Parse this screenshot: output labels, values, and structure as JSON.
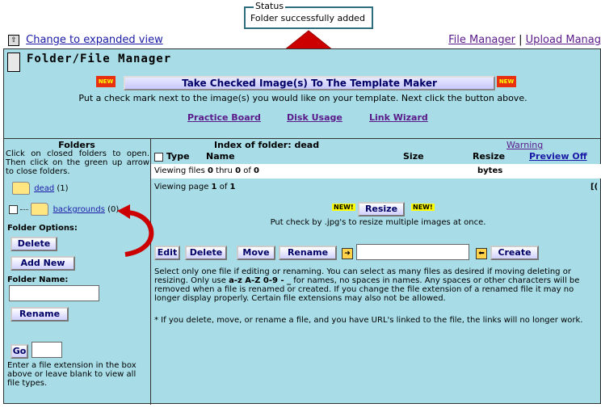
{
  "status": {
    "legend": "Status",
    "message": "Folder successfully added"
  },
  "top": {
    "expanded_link": "Change to expanded view",
    "file_manager_link": "File Manager",
    "separator": "|",
    "upload_link": "Upload Manag"
  },
  "header": {
    "title": "Folder/File Manager",
    "take_button": "Take Checked Image(s) To The Template Maker",
    "new_badge": "NEW",
    "instructions": "Put a check mark next to the image(s) you would like on your template. Next click the button above.",
    "links": [
      "Practice Board",
      "Disk Usage",
      "Link Wizard"
    ]
  },
  "sidebar": {
    "title": "Folders",
    "help": "Click on closed folders to open. Then click on the green up arrow to close folders.",
    "folders": [
      {
        "name": "dead",
        "count": "(1)"
      },
      {
        "name": "backgrounds",
        "count": "(0)"
      }
    ],
    "options_label": "Folder Options:",
    "delete_button": "Delete",
    "add_new_button": "Add New",
    "folder_name_label": "Folder Name:",
    "rename_button": "Rename",
    "go_button": "Go",
    "extension_note": "Enter a file extension in the box above or leave blank to view all file types."
  },
  "main": {
    "index_title": "Index of folder: dead",
    "warning_link": "Warning",
    "columns": [
      "Type",
      "Name",
      "Size",
      "Resize"
    ],
    "preview_link": "Preview Off",
    "viewing_files_prefix": "Viewing files",
    "viewing_files_from": "0",
    "viewing_files_mid": "thru",
    "viewing_files_to": "0",
    "viewing_files_of": "of",
    "viewing_files_total": "0",
    "bytes_label": "bytes",
    "viewing_page_prefix": "Viewing page",
    "page_current": "1",
    "page_of": "of",
    "page_total": "1",
    "page_right_marker": "[(",
    "new_label": "NEW!",
    "resize_button": "Resize",
    "resize_help": "Put check by .jpg's to resize multiple images at once.",
    "actions": {
      "edit": "Edit",
      "delete": "Delete",
      "move": "Move",
      "rename": "Rename",
      "create": "Create"
    },
    "help_1_pre": "Select only one file if editing or renaming. You can select as many files as desired if moving deleting or resizing. Only use ",
    "help_1_chars": "a-z A-Z 0-9 - _",
    "help_1_post": " for names, no spaces in names. Any spaces or other characters will be removed when a file is renamed or created. If you change the file extension of a renamed file it may no longer display properly. Certain file extensions may also not be allowed.",
    "help_2": "* If you delete, move, or rename a file, and you have URL's linked to the file, the links will no longer work."
  },
  "colors": {
    "panel": "#a8dde7",
    "arrow": "#cc0000",
    "link": "#1a1aa6"
  }
}
